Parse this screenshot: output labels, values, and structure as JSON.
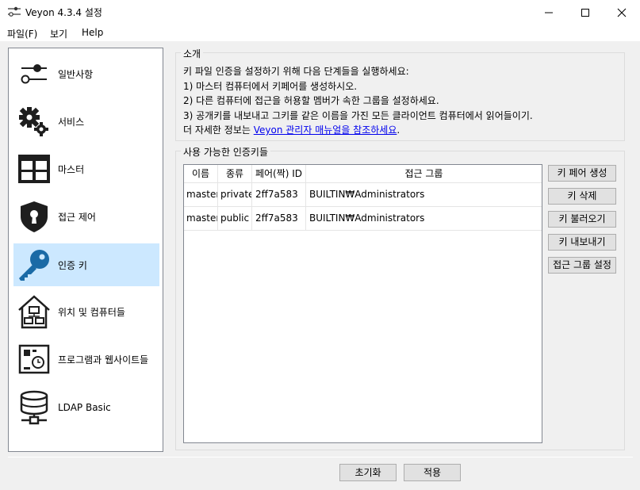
{
  "window": {
    "title": "Veyon  4.3.4 설정",
    "minimize_icon": "minimize-icon",
    "maximize_icon": "maximize-icon",
    "close_icon": "close-icon"
  },
  "menu": [
    "파일(F)",
    "보기",
    "Help"
  ],
  "sidebar": {
    "items": [
      {
        "label": "일반사항",
        "icon": "sliders-icon"
      },
      {
        "label": "서비스",
        "icon": "gears-icon"
      },
      {
        "label": "마스터",
        "icon": "grid-window-icon"
      },
      {
        "label": "접근 제어",
        "icon": "shield-lock-icon"
      },
      {
        "label": "인증 키",
        "icon": "key-icon",
        "selected": true
      },
      {
        "label": "위치 및 컴퓨터들",
        "icon": "house-computers-icon"
      },
      {
        "label": "프로그램과 웹사이트들",
        "icon": "programs-icon"
      },
      {
        "label": "LDAP Basic",
        "icon": "database-network-icon"
      }
    ],
    "selected_color": "#cce8ff"
  },
  "intro": {
    "title": "소개",
    "line1": "키 파일 인증을 설정하기 위해 다음 단계들을 실행하세요:",
    "line2": "1) 마스터 컴퓨터에서 키페어를 생성하시오.",
    "line3": "2) 다른 컴퓨터에 접근을 허용할 멤버가 속한 그룹을 설정하세요.",
    "line4": "3) 공개키를 내보내고 그키를 같은 이름을 가진 모든 클라이언트 컴퓨터에서 읽어들이기.",
    "line5_prefix": "더 자세한 정보는 ",
    "line5_link": "Veyon 관리자 매뉴얼을 참조하세요",
    "line5_suffix": "."
  },
  "keys": {
    "title": "사용 가능한 인증키들",
    "columns": [
      "이름",
      "종류",
      "페어(짝) ID",
      "접근 그룹"
    ],
    "rows": [
      [
        "master",
        "private",
        "2ff7a583",
        "BUILTIN₩Administrators"
      ],
      [
        "master",
        "public",
        "2ff7a583",
        "BUILTIN₩Administrators"
      ]
    ],
    "buttons": [
      "키 페어 생성",
      "키 삭제",
      "키 불러오기",
      "키 내보내기",
      "접근 그룹 설정"
    ]
  },
  "footer": {
    "reset": "초기화",
    "apply": "적용"
  },
  "colors": {
    "link": "#0000ee",
    "icon": "#1e1e1e",
    "key_icon": "#1a6aa6"
  }
}
